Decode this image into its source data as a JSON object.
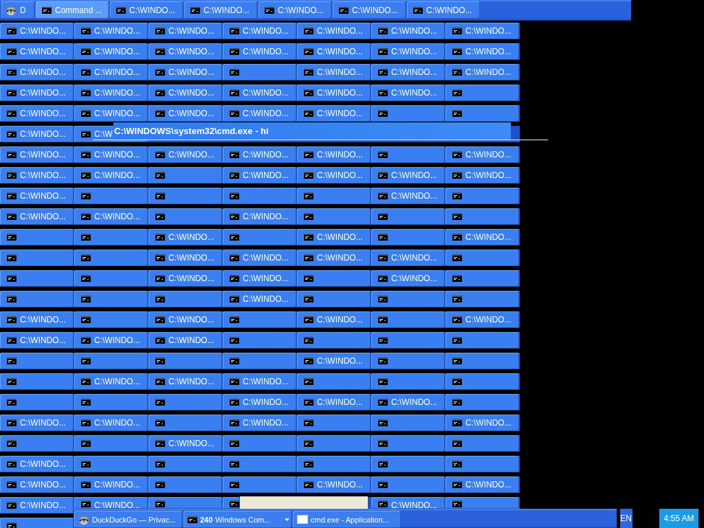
{
  "top_taskbar": {
    "buttons": [
      {
        "kind": "browser",
        "label": "D",
        "selected": false
      },
      {
        "kind": "console",
        "label": "Command ...",
        "selected": true
      },
      {
        "kind": "console",
        "label": "C:\\WINDO...",
        "selected": false
      },
      {
        "kind": "console",
        "label": "C:\\WINDO...",
        "selected": false
      },
      {
        "kind": "console",
        "label": "C:\\WINDO...",
        "selected": false
      },
      {
        "kind": "console",
        "label": "C:\\WINDO...",
        "selected": false
      },
      {
        "kind": "console",
        "label": "C:\\WINDO...",
        "selected": false
      }
    ]
  },
  "button_rows": [
    {
      "buttons": [
        {
          "label": "C:\\WINDO...",
          "selected": false
        },
        {
          "label": "C:\\WINDO...",
          "selected": false
        },
        {
          "label": "C:\\WINDO...",
          "selected": false
        },
        {
          "label": "C:\\WINDO...",
          "selected": false
        },
        {
          "label": "C:\\WINDO...",
          "selected": false
        },
        {
          "label": "C:\\WINDO...",
          "selected": false
        },
        {
          "label": "C:\\WINDO...",
          "selected": false
        }
      ]
    },
    {
      "buttons": [
        {
          "label": "C:\\WINDO...",
          "selected": false
        },
        {
          "label": "C:\\WINDO...",
          "selected": false
        },
        {
          "label": "C:\\WINDO...",
          "selected": false
        },
        {
          "label": "C:\\WINDO...",
          "selected": false
        },
        {
          "label": "C:\\WINDO...",
          "selected": false
        },
        {
          "label": "C:\\WINDO...",
          "selected": false
        },
        {
          "label": "C:\\WINDO...",
          "selected": false
        }
      ]
    },
    {
      "buttons": [
        {
          "label": "C:\\WINDO...",
          "selected": false
        },
        {
          "label": "C:\\WINDO...",
          "selected": false
        },
        {
          "label": "C:\\WINDO...",
          "selected": false
        },
        {
          "selected": false
        },
        {
          "label": "C:\\WINDO...",
          "selected": false
        },
        {
          "label": "C:\\WINDO...",
          "selected": false
        },
        {
          "label": "C:\\WINDO...",
          "selected": false
        }
      ]
    },
    {
      "buttons": [
        {
          "label": "C:\\WINDO...",
          "selected": false
        },
        {
          "label": "C:\\WINDO...",
          "selected": false
        },
        {
          "label": "C:\\WINDO...",
          "selected": false
        },
        {
          "label": "C:\\WINDO...",
          "selected": false
        },
        {
          "label": "C:\\WINDO...",
          "selected": false
        },
        {
          "label": "C:\\WINDO...",
          "selected": false
        },
        {
          "selected": false
        }
      ]
    },
    {
      "buttons": [
        {
          "label": "C:\\WINDO...",
          "selected": false
        },
        {
          "label": "C:\\WINDO...",
          "selected": false
        },
        {
          "label": "C:\\WINDO...",
          "selected": false
        },
        {
          "label": "C:\\WINDO...",
          "selected": false
        },
        {
          "label": "C:\\WINDO...",
          "selected": false
        },
        {
          "selected": false
        },
        {
          "selected": false
        }
      ]
    },
    {
      "buttons": [
        {
          "label": "C:\\WINDO...",
          "selected": false
        },
        {
          "label": "C:\\W",
          "selected": false
        }
      ],
      "tooltip": {
        "title": "C:\\WINDOWS\\system32\\cmd.exe - hi"
      }
    },
    {
      "buttons": [
        {
          "label": "C:\\WINDO...",
          "selected": false
        },
        {
          "label": "C:\\WINDO...",
          "selected": false
        },
        {
          "label": "C:\\WINDO...",
          "selected": false
        },
        {
          "label": "C:\\WINDO...",
          "selected": false
        },
        {
          "label": "C:\\WINDO...",
          "selected": false
        },
        {
          "selected": false
        },
        {
          "label": "C:\\WINDO...",
          "selected": false
        }
      ]
    },
    {
      "buttons": [
        {
          "label": "C:\\WINDO...",
          "selected": false
        },
        {
          "label": "C:\\WINDO...",
          "selected": false
        },
        {
          "selected": false
        },
        {
          "label": "C:\\WINDO...",
          "selected": false
        },
        {
          "label": "C:\\WINDO...",
          "selected": false
        },
        {
          "label": "C:\\WINDO...",
          "selected": false
        },
        {
          "label": "C:\\WINDO...",
          "selected": false
        }
      ]
    },
    {
      "buttons": [
        {
          "label": "C:\\WINDO...",
          "selected": false
        },
        {
          "selected": false
        },
        {
          "selected": false
        },
        {
          "selected": false
        },
        {
          "selected": false
        },
        {
          "label": "C:\\WINDO...",
          "selected": false
        },
        {
          "selected": false
        }
      ]
    },
    {
      "buttons": [
        {
          "label": "C:\\WINDO...",
          "selected": false
        },
        {
          "label": "C:\\WINDO...",
          "selected": false
        },
        {
          "selected": false
        },
        {
          "label": "C:\\WINDO...",
          "selected": false
        },
        {
          "selected": false
        },
        {
          "selected": false
        },
        {
          "selected": false
        }
      ]
    },
    {
      "buttons": [
        {
          "selected": false
        },
        {
          "selected": false
        },
        {
          "label": "C:\\WINDO...",
          "selected": false
        },
        {
          "selected": false
        },
        {
          "label": "C:\\WINDO...",
          "selected": false
        },
        {
          "selected": false
        },
        {
          "label": "C:\\WINDO...",
          "selected": false
        }
      ]
    },
    {
      "buttons": [
        {
          "selected": false
        },
        {
          "selected": false
        },
        {
          "label": "C:\\WINDO...",
          "selected": false
        },
        {
          "label": "C:\\WINDO...",
          "selected": false
        },
        {
          "label": "C:\\WINDO...",
          "selected": false
        },
        {
          "label": "C:\\WINDO...",
          "selected": false
        },
        {
          "selected": false
        }
      ]
    },
    {
      "buttons": [
        {
          "selected": false
        },
        {
          "selected": false
        },
        {
          "label": "C:\\WINDO...",
          "selected": false
        },
        {
          "label": "C:\\WINDO...",
          "selected": false
        },
        {
          "selected": false
        },
        {
          "label": "C:\\WINDO...",
          "selected": false
        },
        {
          "selected": false
        }
      ]
    },
    {
      "buttons": [
        {
          "selected": false
        },
        {
          "selected": false
        },
        {
          "selected": false
        },
        {
          "label": "C:\\WINDO...",
          "selected": false
        },
        {
          "selected": false
        },
        {
          "selected": false
        },
        {
          "selected": false
        }
      ]
    },
    {
      "buttons": [
        {
          "label": "C:\\WINDO...",
          "selected": false
        },
        {
          "selected": false
        },
        {
          "label": "C:\\WINDO...",
          "selected": false
        },
        {
          "selected": false
        },
        {
          "label": "C:\\WINDO...",
          "selected": false
        },
        {
          "selected": false
        },
        {
          "label": "C:\\WINDO...",
          "selected": false
        }
      ]
    },
    {
      "buttons": [
        {
          "label": "C:\\WINDO...",
          "selected": false
        },
        {
          "label": "C:\\WINDO...",
          "selected": false
        },
        {
          "label": "C:\\WINDO...",
          "selected": false
        },
        {
          "selected": false
        },
        {
          "selected": false
        },
        {
          "selected": false
        },
        {
          "selected": false
        }
      ]
    },
    {
      "buttons": [
        {
          "selected": false
        },
        {
          "selected": false
        },
        {
          "selected": false
        },
        {
          "selected": false
        },
        {
          "label": "C:\\WINDO...",
          "selected": false
        },
        {
          "selected": false
        },
        {
          "selected": false
        }
      ]
    },
    {
      "buttons": [
        {
          "selected": false
        },
        {
          "label": "C:\\WINDO...",
          "selected": false
        },
        {
          "label": "C:\\WINDO...",
          "selected": false
        },
        {
          "label": "C:\\WINDO...",
          "selected": false
        },
        {
          "selected": false
        },
        {
          "selected": false
        },
        {
          "selected": false
        }
      ]
    },
    {
      "buttons": [
        {
          "selected": false
        },
        {
          "selected": false
        },
        {
          "selected": false
        },
        {
          "label": "C:\\WINDO...",
          "selected": false
        },
        {
          "label": "C:\\WINDO...",
          "selected": false
        },
        {
          "label": "C:\\WINDO...",
          "selected": false
        },
        {
          "selected": false
        }
      ]
    },
    {
      "buttons": [
        {
          "label": "C:\\WINDO...",
          "selected": false
        },
        {
          "label": "C:\\WINDO...",
          "selected": false
        },
        {
          "selected": false
        },
        {
          "label": "C:\\WINDO...",
          "selected": false
        },
        {
          "selected": false
        },
        {
          "selected": false
        },
        {
          "label": "C:\\WINDO...",
          "selected": false
        }
      ]
    },
    {
      "buttons": [
        {
          "selected": false
        },
        {
          "selected": false
        },
        {
          "label": "C:\\WINDO...",
          "selected": false
        },
        {
          "selected": false
        },
        {
          "selected": false
        },
        {
          "selected": false
        },
        {
          "selected": false
        }
      ]
    },
    {
      "buttons": [
        {
          "label": "C:\\WINDO...",
          "selected": false
        },
        {
          "selected": false
        },
        {
          "selected": false
        },
        {
          "selected": false
        },
        {
          "selected": false
        },
        {
          "selected": false
        },
        {
          "selected": false
        }
      ]
    },
    {
      "buttons": [
        {
          "label": "C:\\WINDO...",
          "selected": false
        },
        {
          "label": "C:\\WINDO...",
          "selected": false
        },
        {
          "selected": false
        },
        {
          "selected": false
        },
        {
          "label": "C:\\WINDO...",
          "selected": false
        },
        {
          "selected": false
        },
        {
          "label": "C:\\WINDO...",
          "selected": false
        }
      ]
    },
    {
      "buttons": [
        {
          "kind": "button",
          "label": "C:\\WINDO...",
          "selected": false
        },
        {
          "kind": "button",
          "label": "C:\\WINDO...",
          "selected": false
        },
        {
          "kind": "button",
          "selected": false
        },
        {
          "kind": "button",
          "selected": false
        },
        {
          "kind": "panel"
        },
        {
          "kind": "button",
          "label": "C:\\WINDO...",
          "selected": false
        },
        {
          "kind": "button",
          "selected": false
        }
      ]
    },
    {
      "buttons": [
        {
          "selected": false
        }
      ]
    }
  ],
  "bottom_taskbar": {
    "buttons": [
      {
        "kind": "browser",
        "label": "DuckDuckGo — Privac...",
        "selected": false
      },
      {
        "kind": "group",
        "count": "240",
        "label": "Windows Com...",
        "selected": false
      },
      {
        "kind": "window",
        "label": "cmd.exe - Application...",
        "selected": false
      }
    ]
  },
  "language_indicator": "EN",
  "clock": "4:55 AM"
}
